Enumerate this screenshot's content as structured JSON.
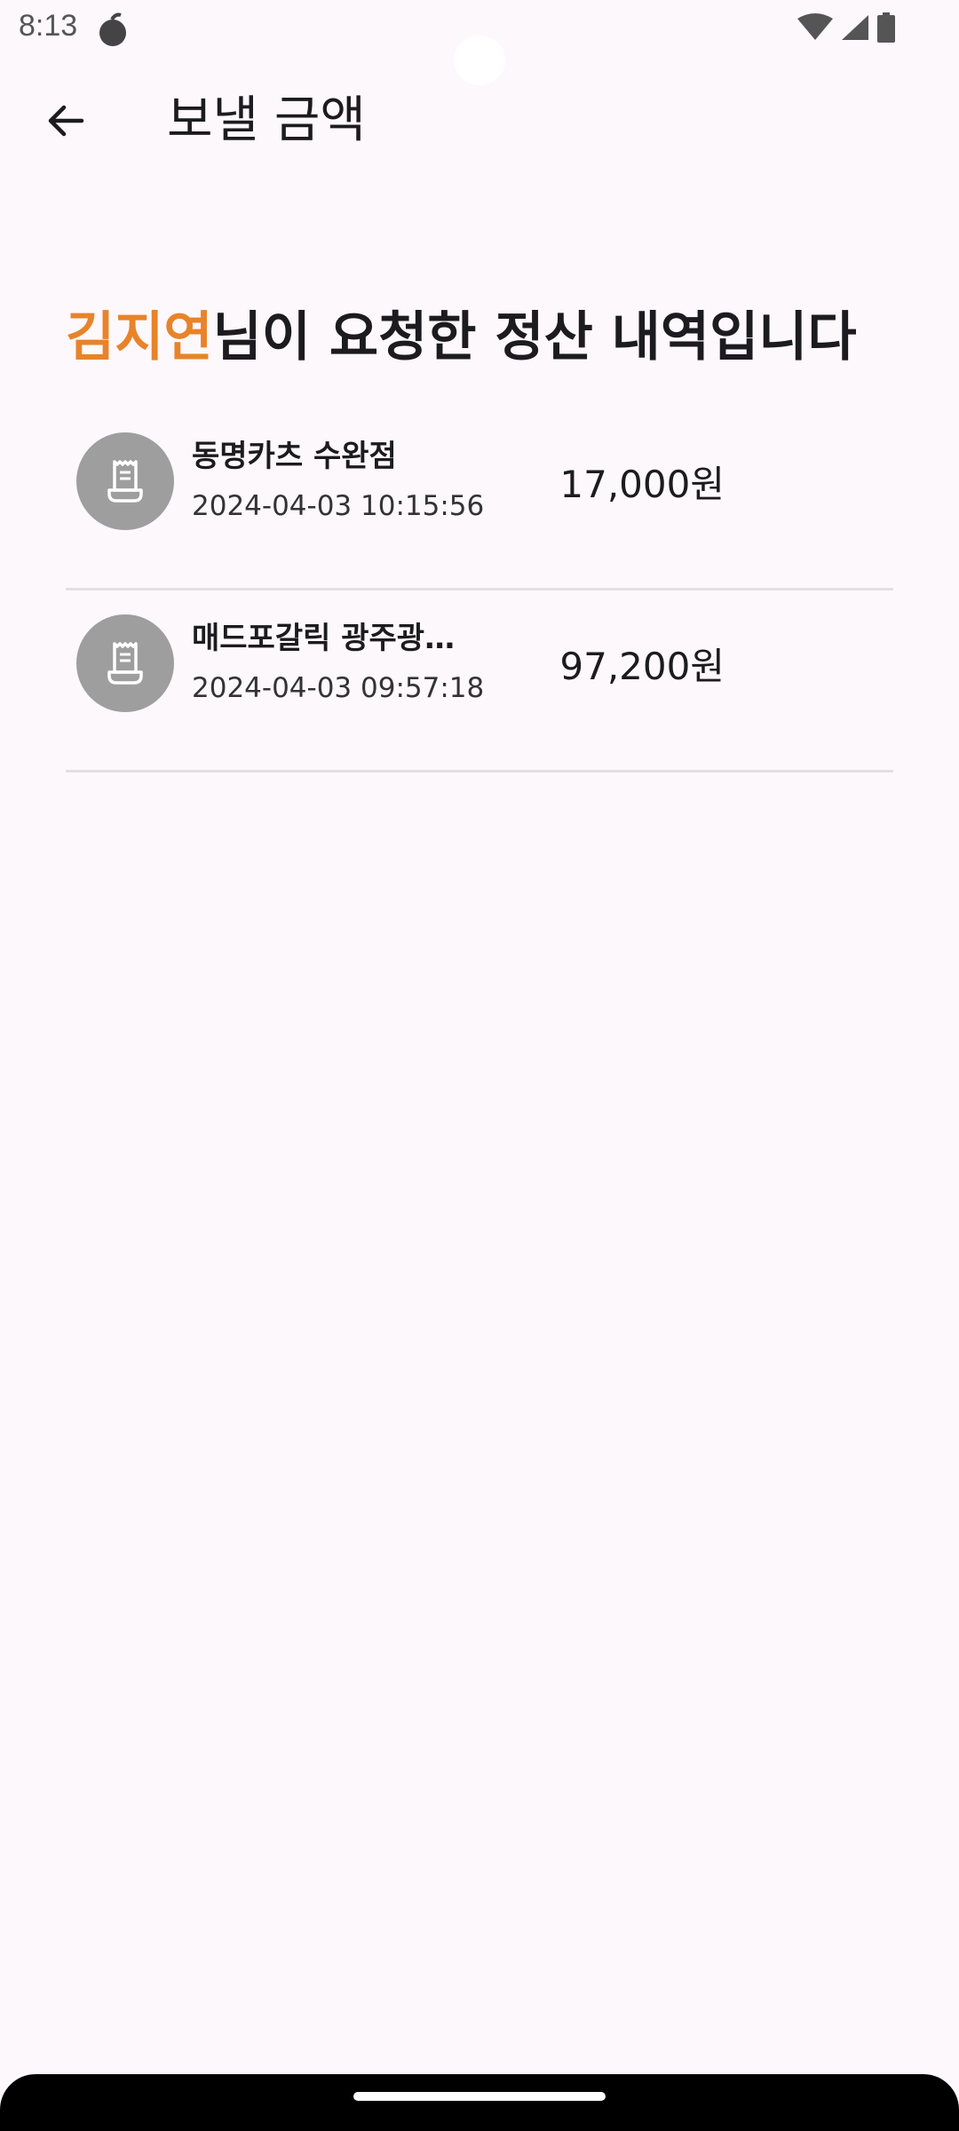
{
  "status_bar": {
    "time": "8:13"
  },
  "header": {
    "title": "보낼 금액"
  },
  "heading": {
    "name": "김지연",
    "suffix": "님이 요청한 정산 내역입니다",
    "accent_color": "#e8832a"
  },
  "items": [
    {
      "merchant": "동명카츠 수완점",
      "date": "2024-04-03 10:15:56",
      "amount": "17,000원",
      "icon": "receipt-icon"
    },
    {
      "merchant": "매드포갈릭 광주광…",
      "date": "2024-04-03 09:57:18",
      "amount": "97,200원",
      "icon": "receipt-icon"
    }
  ]
}
